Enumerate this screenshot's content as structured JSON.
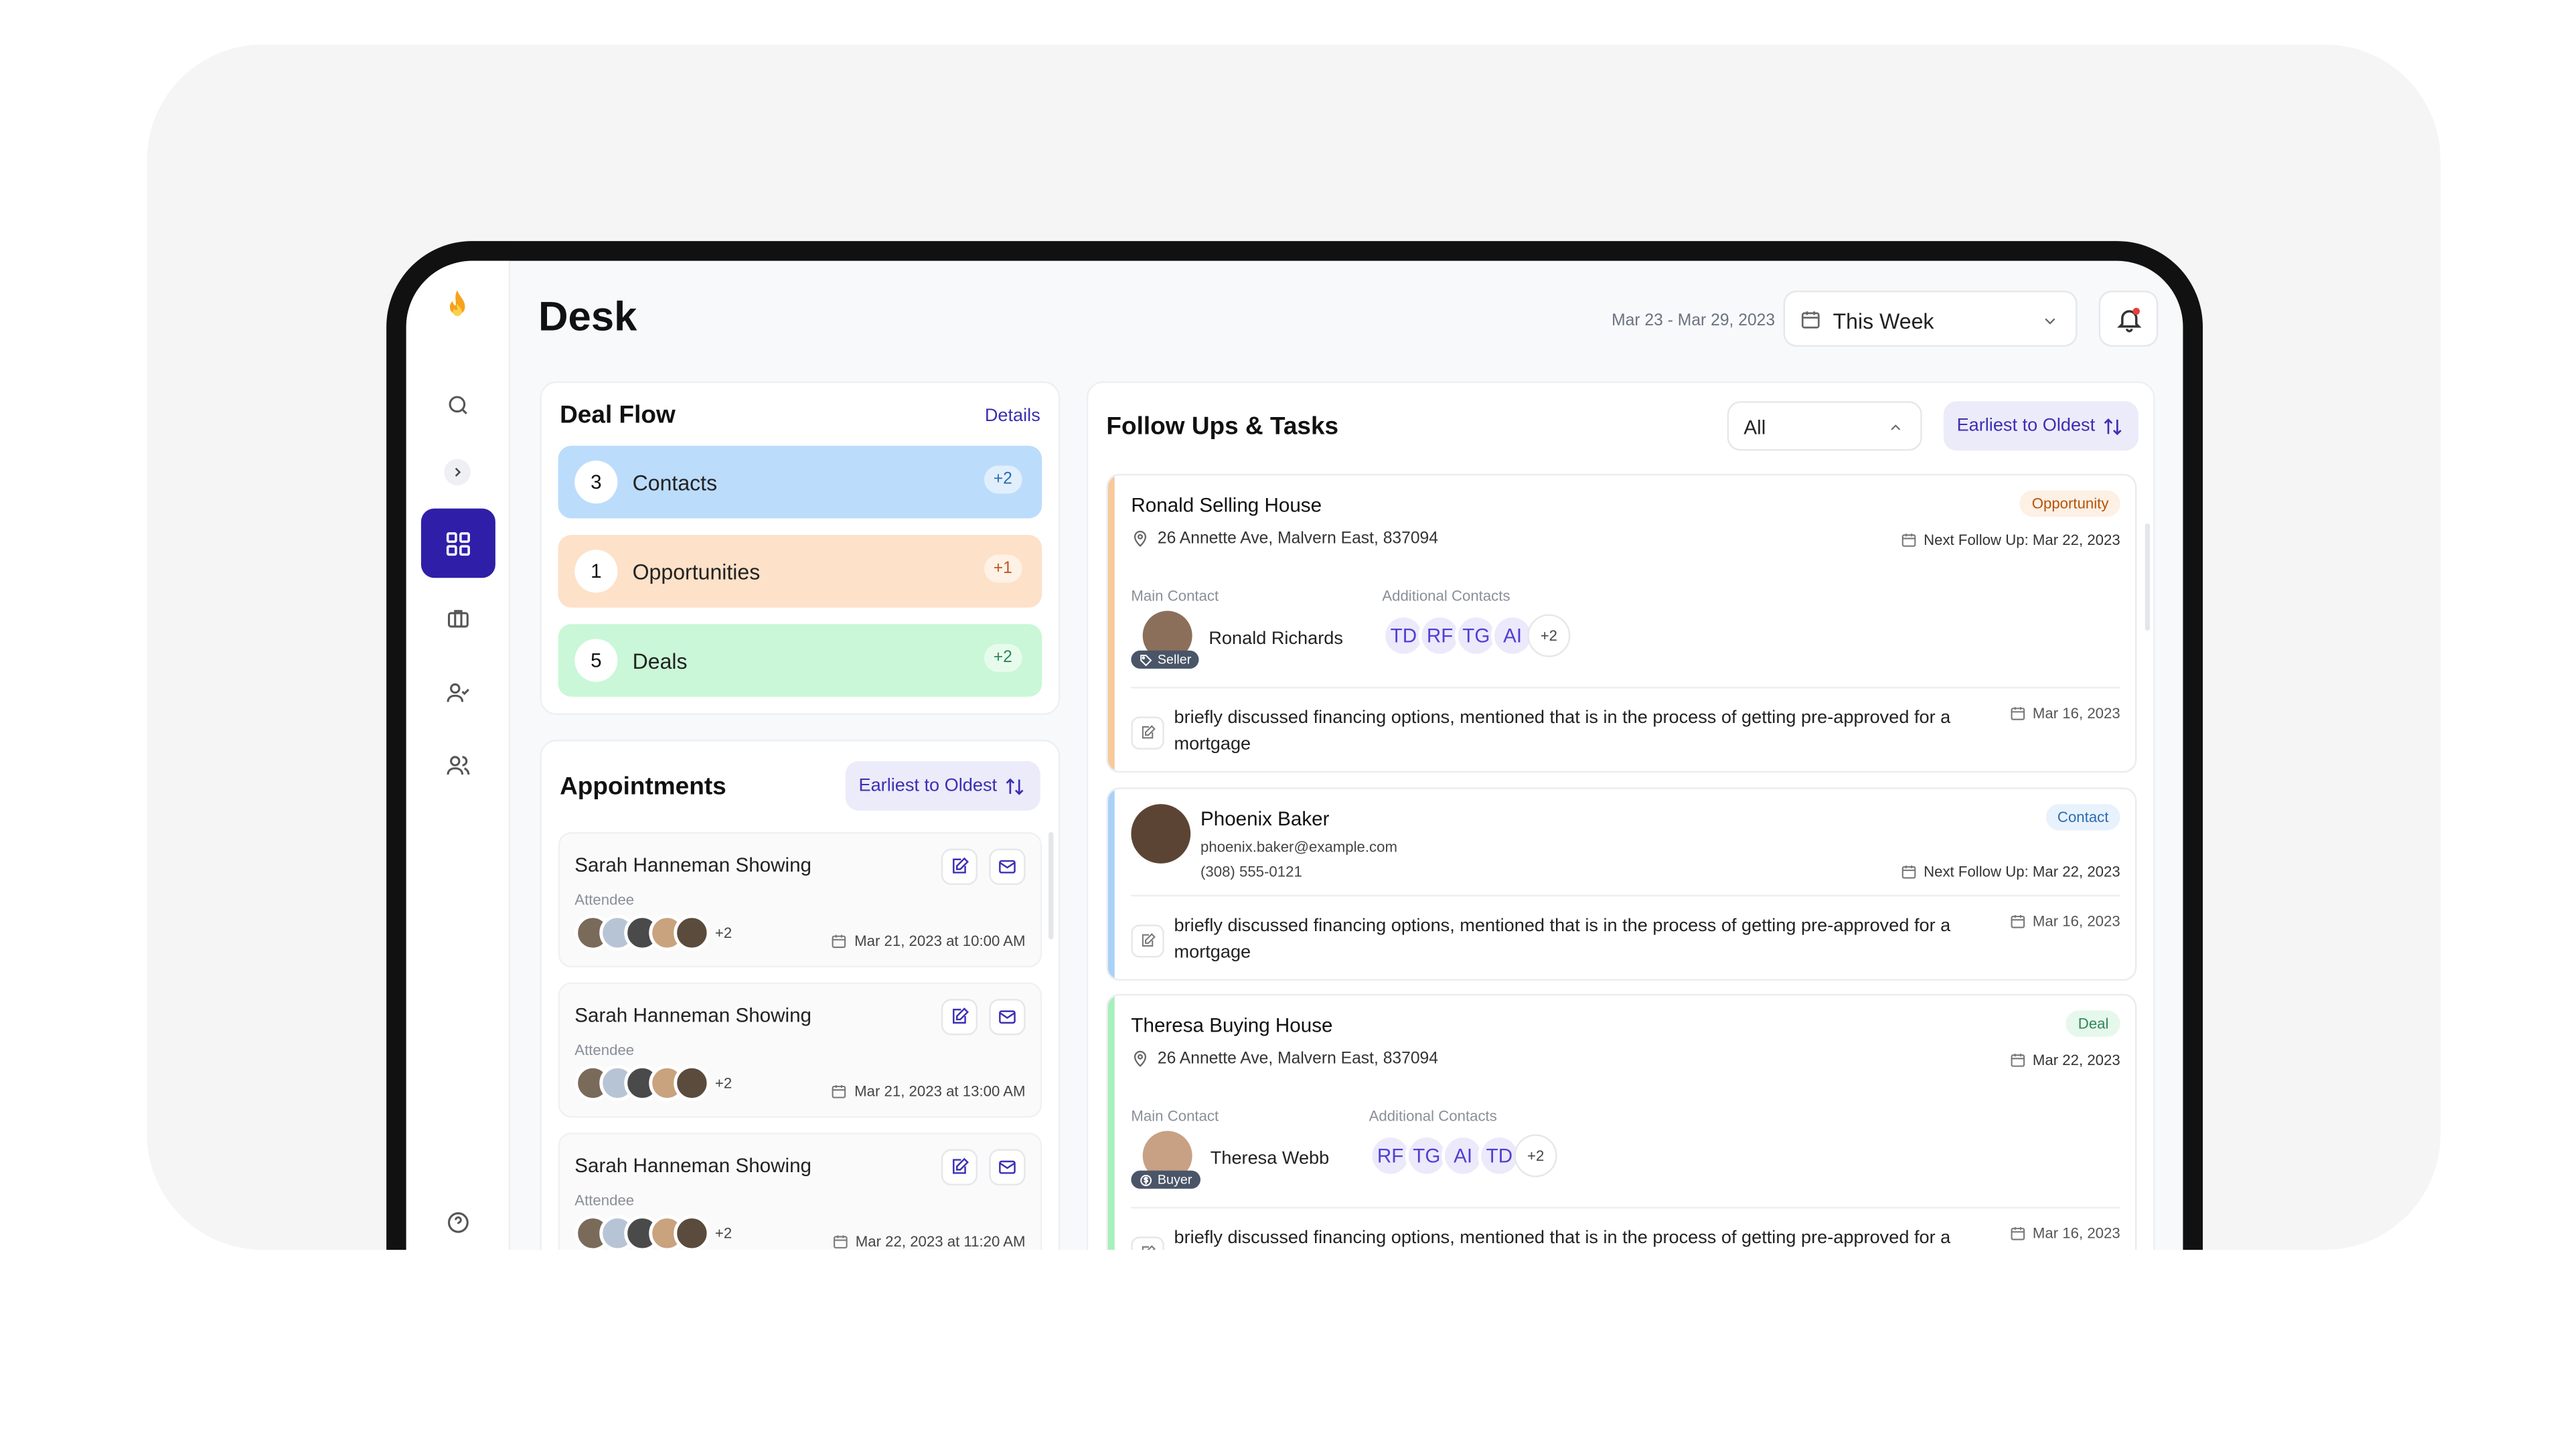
{
  "app": {
    "title": "Desk",
    "date_range": "Mar 23 - Mar 29, 2023",
    "period": "This Week"
  },
  "colors": {
    "accent": "#2f1fa8",
    "contacts": "#bcdcfb",
    "opportunities": "#fde1c8",
    "deals": "#c9f7d7"
  },
  "sidebar": {
    "icons": [
      "flame-logo-icon",
      "search-icon",
      "chevron-right-icon",
      "dashboard-grid-icon",
      "briefcase-icon",
      "user-check-icon",
      "users-icon",
      "help-icon"
    ]
  },
  "deal_flow": {
    "title": "Deal Flow",
    "details_label": "Details",
    "items": [
      {
        "count": "3",
        "label": "Contacts",
        "delta": "+2"
      },
      {
        "count": "1",
        "label": "Opportunities",
        "delta": "+1"
      },
      {
        "count": "5",
        "label": "Deals",
        "delta": "+2"
      }
    ]
  },
  "appointments": {
    "title": "Appointments",
    "sort_label": "Earliest to Oldest",
    "attendee_label": "Attendee",
    "items": [
      {
        "title": "Sarah Hanneman Showing",
        "extra": "+2",
        "datetime": "Mar 21, 2023 at 10:00 AM"
      },
      {
        "title": "Sarah Hanneman Showing",
        "extra": "+2",
        "datetime": "Mar 21, 2023 at 13:00 AM"
      },
      {
        "title": "Sarah Hanneman Showing",
        "extra": "+2",
        "datetime": "Mar 22, 2023 at 11:20 AM"
      }
    ]
  },
  "followups": {
    "title": "Follow Ups & Tasks",
    "filter_value": "All",
    "sort_label": "Earliest to Oldest",
    "main_contact_label": "Main Contact",
    "additional_contacts_label": "Additional Contacts",
    "items": [
      {
        "name": "Ronald Selling House",
        "tag": "Opportunity",
        "address": "26 Annette Ave, Malvern East, 837094",
        "next_follow_up": "Next Follow Up: Mar 22, 2023",
        "main_contact": "Ronald Richards",
        "role": "Seller",
        "additional": [
          "TD",
          "RF",
          "TG",
          "AI"
        ],
        "additional_more": "+2",
        "note": "briefly discussed financing options, mentioned that is in the process of getting pre-approved for a mortgage",
        "note_date": "Mar 16, 2023"
      },
      {
        "name": "Phoenix Baker",
        "tag": "Contact",
        "email": "phoenix.baker@example.com",
        "phone": "(308) 555-0121",
        "next_follow_up": "Next Follow Up: Mar 22, 2023",
        "note": "briefly discussed financing options, mentioned that is in the process of getting pre-approved for a mortgage",
        "note_date": "Mar 16, 2023"
      },
      {
        "name": "Theresa Buying House",
        "tag": "Deal",
        "address": "26 Annette Ave, Malvern East, 837094",
        "next_follow_up": "Mar 22, 2023",
        "main_contact": "Theresa Webb",
        "role": "Buyer",
        "additional": [
          "RF",
          "TG",
          "AI",
          "TD"
        ],
        "additional_more": "+2",
        "note": "briefly discussed financing options, mentioned that is in the process of getting pre-approved for a",
        "note_date": "Mar 16, 2023"
      }
    ]
  }
}
